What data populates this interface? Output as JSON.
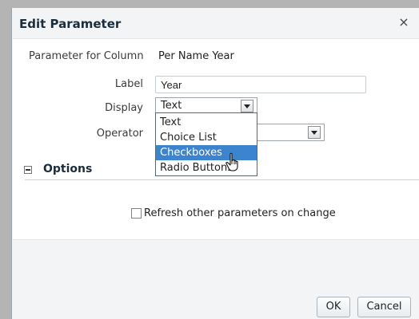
{
  "dialog": {
    "title": "Edit Parameter",
    "close_glyph": "×"
  },
  "form": {
    "parameter_for_column_label": "Parameter for Column",
    "parameter_for_column_value": "Per Name Year",
    "label_label": "Label",
    "label_value": "Year",
    "display_label": "Display",
    "display_value": "Text",
    "operator_label": "Operator"
  },
  "display_dropdown": {
    "options": [
      "Text",
      "Choice List",
      "Checkboxes",
      "Radio Buttons"
    ],
    "highlighted": "Checkboxes"
  },
  "options_section": {
    "title": "Options",
    "refresh_checkbox_label": "Refresh other parameters on change",
    "refresh_checked": false
  },
  "buttons": {
    "ok": "OK",
    "cancel": "Cancel"
  },
  "colors": {
    "highlight": "#3d84ce",
    "title_text": "#1b2d3c"
  },
  "icons": {
    "cursor": "hand-pointer-icon",
    "collapse": "collapse-minus-icon",
    "dropdown": "chevron-down-icon"
  }
}
